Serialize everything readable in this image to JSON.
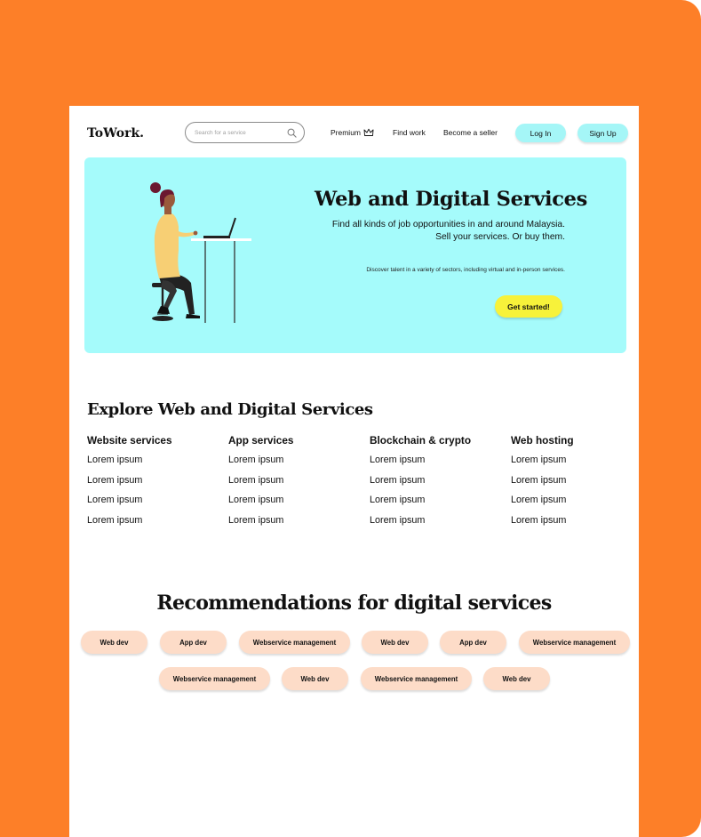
{
  "header": {
    "logo": "ToWork.",
    "search_placeholder": "Search for a service",
    "nav": {
      "premium": "Premium",
      "find_work": "Find work",
      "become_seller": "Become a seller"
    },
    "login": "Log In",
    "signup": "Sign Up"
  },
  "hero": {
    "title": "Web and Digital Services",
    "description": "Find all kinds of job opportunities in and around Malaysia. Sell your services. Or buy them.",
    "subtext": "Discover talent in a variety of sectors, including virtual and in-person services.",
    "cta": "Get started!"
  },
  "explore": {
    "title": "Explore Web and Digital Services",
    "categories": [
      {
        "title": "Website services",
        "items": [
          "Lorem ipsum",
          "Lorem ipsum",
          "Lorem ipsum",
          "Lorem ipsum"
        ]
      },
      {
        "title": "App services",
        "items": [
          "Lorem ipsum",
          "Lorem ipsum",
          "Lorem ipsum",
          "Lorem ipsum"
        ]
      },
      {
        "title": "Blockchain & crypto",
        "items": [
          "Lorem ipsum",
          "Lorem ipsum",
          "Lorem ipsum",
          "Lorem ipsum"
        ]
      },
      {
        "title": "Web hosting",
        "items": [
          "Lorem ipsum",
          "Lorem ipsum",
          "Lorem ipsum",
          "Lorem ipsum"
        ]
      }
    ]
  },
  "recommendations": {
    "title": "Recommendations for digital services",
    "tags": [
      "Web dev",
      "App dev",
      "Webservice management",
      "Web dev",
      "App dev",
      "Webservice management",
      "Webservice management",
      "Web dev",
      "Webservice management",
      "Web dev"
    ]
  },
  "colors": {
    "frame": "#fd7f28",
    "hero_bg": "#a5fbfb",
    "button_cyan": "#a5f6f7",
    "cta_yellow": "#f7f23a",
    "tag_peach": "#fddcc8"
  },
  "icons": {
    "search": "search-icon",
    "premium": "crown-icon"
  }
}
